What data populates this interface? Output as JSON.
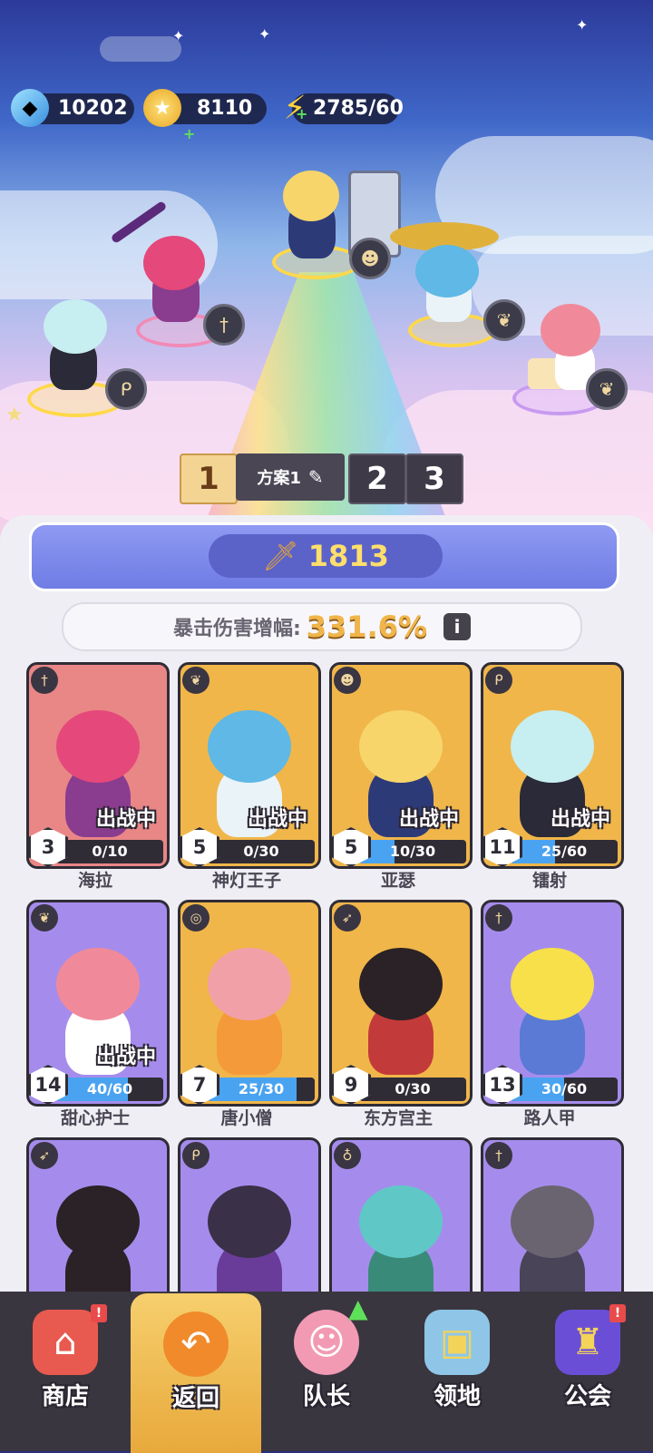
{
  "resources": {
    "diamonds": "10202",
    "coins": "8110",
    "energy": "2785/60"
  },
  "plan": {
    "tabs": [
      "1",
      "2",
      "3"
    ],
    "active_label": "方案1"
  },
  "power": "1813",
  "crit": {
    "label": "暴击伤害增幅:",
    "value": "331.6%",
    "info": "i"
  },
  "fighting_label": "出战中",
  "heroes": [
    {
      "name": "海拉",
      "level": "3",
      "progress": "0/10",
      "fill": 0.0,
      "in_battle": true,
      "class_icon": "dagger-icon",
      "bg": "#e98686"
    },
    {
      "name": "神灯王子",
      "level": "5",
      "progress": "0/30",
      "fill": 0.0,
      "in_battle": true,
      "class_icon": "wings-icon",
      "bg": "#f0b64a"
    },
    {
      "name": "亚瑟",
      "level": "5",
      "progress": "10/30",
      "fill": 0.333,
      "in_battle": true,
      "class_icon": "mask-icon",
      "bg": "#f0b64a"
    },
    {
      "name": "镭射",
      "level": "11",
      "progress": "25/60",
      "fill": 0.417,
      "in_battle": true,
      "class_icon": "magic-icon",
      "bg": "#f0b64a"
    },
    {
      "name": "甜心护士",
      "level": "14",
      "progress": "40/60",
      "fill": 0.667,
      "in_battle": true,
      "class_icon": "wings-icon",
      "bg": "#a58cec"
    },
    {
      "name": "唐小僧",
      "level": "7",
      "progress": "25/30",
      "fill": 0.833,
      "in_battle": false,
      "class_icon": "swirl-icon",
      "bg": "#f0b64a"
    },
    {
      "name": "东方宫主",
      "level": "9",
      "progress": "0/30",
      "fill": 0.0,
      "in_battle": false,
      "class_icon": "bow-icon",
      "bg": "#f0b64a"
    },
    {
      "name": "路人甲",
      "level": "13",
      "progress": "30/60",
      "fill": 0.5,
      "in_battle": false,
      "class_icon": "dagger-icon",
      "bg": "#a58cec"
    },
    {
      "name": "",
      "level": "",
      "progress": "",
      "fill": 0.0,
      "in_battle": false,
      "class_icon": "bow-icon",
      "bg": "#a58cec"
    },
    {
      "name": "",
      "level": "",
      "progress": "",
      "fill": 0.0,
      "in_battle": false,
      "class_icon": "magic-icon",
      "bg": "#a58cec"
    },
    {
      "name": "",
      "level": "",
      "progress": "",
      "fill": 0.0,
      "in_battle": false,
      "class_icon": "potion-icon",
      "bg": "#a58cec"
    },
    {
      "name": "",
      "level": "",
      "progress": "",
      "fill": 0.0,
      "in_battle": false,
      "class_icon": "dagger-icon",
      "bg": "#a58cec"
    }
  ],
  "nav": [
    {
      "label": "商店",
      "icon": "shop-icon",
      "notify": "!"
    },
    {
      "label": "返回",
      "icon": "back-icon",
      "notify": ""
    },
    {
      "label": "队长",
      "icon": "captain-icon",
      "notify": ""
    },
    {
      "label": "领地",
      "icon": "territory-icon",
      "notify": ""
    },
    {
      "label": "公会",
      "icon": "guild-icon",
      "notify": "!"
    }
  ]
}
